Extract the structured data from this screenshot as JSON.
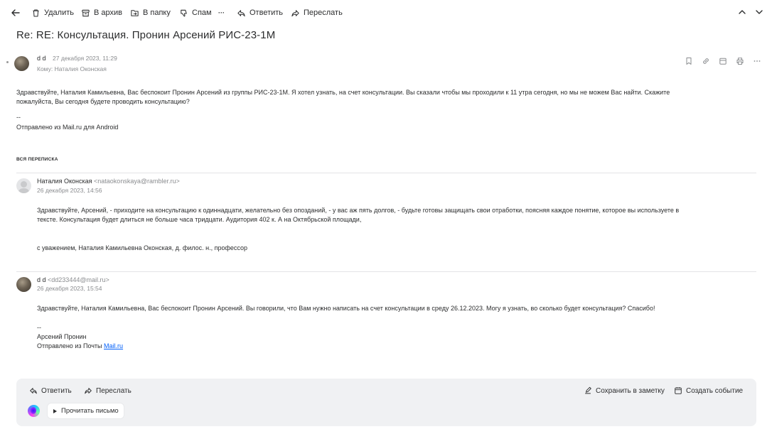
{
  "toolbar": {
    "delete": "Удалить",
    "archive": "В архив",
    "to_folder": "В папку",
    "spam": "Спам",
    "more": "···",
    "reply": "Ответить",
    "forward": "Переслать"
  },
  "subject": "Re: RE: Консультация. Пронин Арсений РИС-23-1М",
  "message": {
    "sender_name": "d d",
    "date": "27 декабря 2023, 11:29",
    "to": "Кому: Наталия Оконская",
    "body_line1": "Здравствуйте, Наталия Камильевна, Вас беспокоит Пронин Арсений из группы РИС-23-1М. Я хотел узнать, на счет консультации. Вы сказали чтобы мы проходили к 11 утра сегодня, но мы не можем Вас найти. Скажите",
    "body_line2": "пожалуйста, Вы сегодня будете проводить консультацию?",
    "sig_dash": "--",
    "signature": "Отправлено из Mail.ru для Android"
  },
  "thread": {
    "label": "вся переписка",
    "items": [
      {
        "sender_name": "Наталия Оконская",
        "sender_email": "<nataokonskaya@rambler.ru>",
        "date": "26 декабря 2023, 14:56",
        "body_line1": "Здравствуйте, Арсений, - приходите на консультацию к одиннадцати, желательно без опозданий, - у вас аж пять долгов, - будьте готовы защищать свои отработки, поясняя каждое понятие, которое вы используете в",
        "body_line2": "тексте. Консультация будет длиться не больше часа тридцати. Аудитория 402 к. А на Октябрьской площади,",
        "signature": "с уважением, Наталия Камильевна Оконская, д. филос. н., профессор"
      },
      {
        "sender_name": "d d",
        "sender_email": "<dd233444@mail.ru>",
        "date": "26 декабря 2023, 15:54",
        "body_line1": "Здравствуйте, Наталия Камильевна, Вас беспокоит Пронин Арсений. Вы говорили, что Вам нужно написать на счет консультации в среду 26.12.2023. Могу я узнать, во сколько будет консультация? Спасибо!",
        "sig_dash": "--",
        "sig_name": "Арсений Пронин",
        "sig_sent": "Отправлено из Почты",
        "sig_link": "Mail.ru"
      }
    ]
  },
  "footer": {
    "reply": "Ответить",
    "forward": "Переслать",
    "save_note": "Сохранить в заметку",
    "create_event": "Создать событие",
    "read_aloud": "Прочитать письмо"
  }
}
